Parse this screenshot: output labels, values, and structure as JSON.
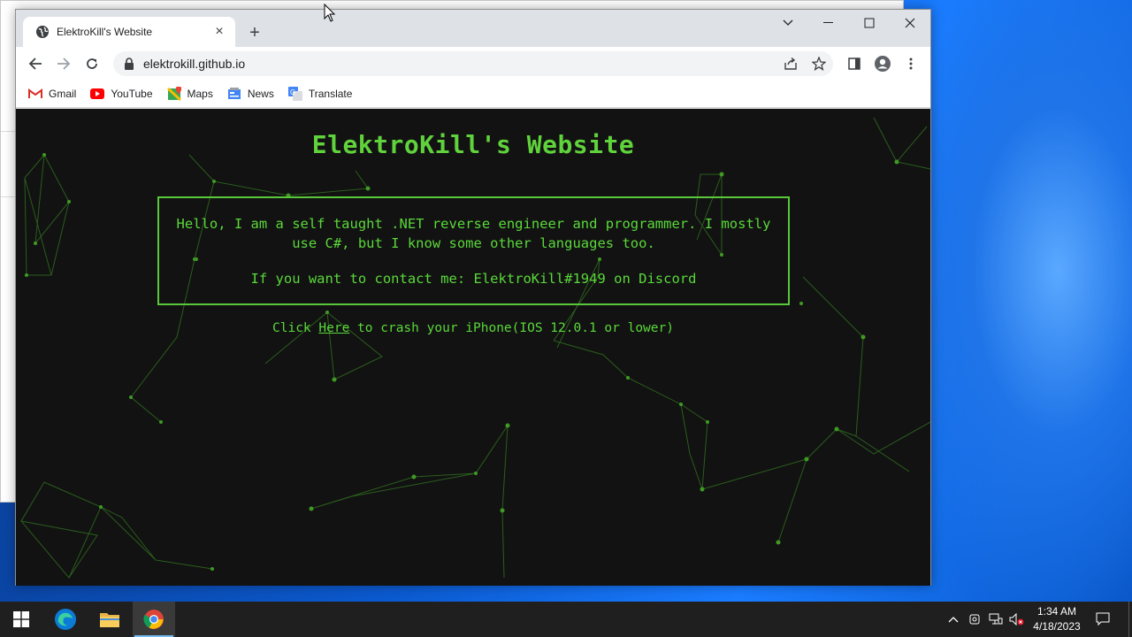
{
  "browser": {
    "tab_title": "ElektroKill's Website",
    "url": "elektrokill.github.io",
    "bookmarks": [
      {
        "label": "Gmail",
        "icon": "gmail-icon"
      },
      {
        "label": "YouTube",
        "icon": "youtube-icon"
      },
      {
        "label": "Maps",
        "icon": "maps-icon"
      },
      {
        "label": "News",
        "icon": "news-icon"
      },
      {
        "label": "Translate",
        "icon": "translate-icon"
      }
    ]
  },
  "page": {
    "title": "ElektroKill's Website",
    "intro_line1": "Hello, I am a self taught .NET reverse engineer and programmer. I mostly",
    "intro_line2": "use C#, but I know some other languages too.",
    "contact": "If you want to contact me: ElektroKill#1949 on Discord",
    "crash_prefix": "Click ",
    "crash_link": "Here",
    "crash_suffix": " to crash your iPhone(IOS 12.0.1 or lower)",
    "accent_color": "#5ad83a",
    "background_color": "#121212"
  },
  "taskbar": {
    "time": "1:34 AM",
    "date": "4/18/2023"
  }
}
